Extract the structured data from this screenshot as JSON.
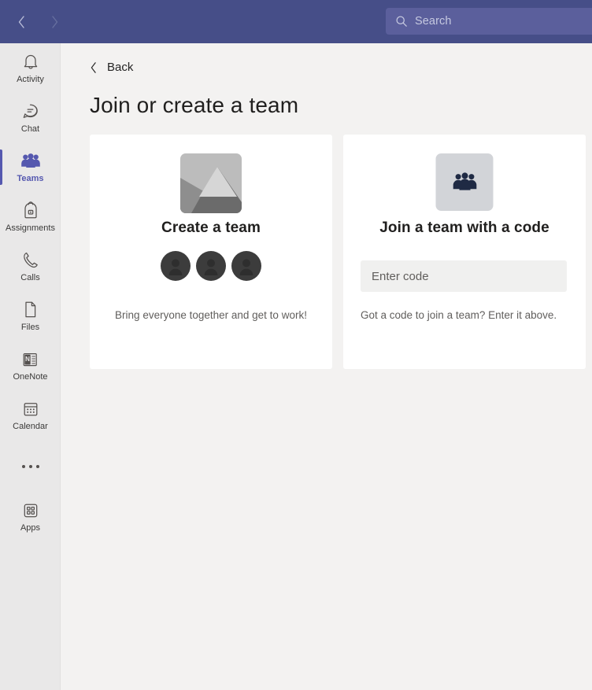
{
  "titlebar": {
    "back_arrow_icon": "chevron-left-icon",
    "forward_arrow_icon": "chevron-right-icon",
    "search": {
      "icon": "search-icon",
      "placeholder": "Search",
      "value": ""
    }
  },
  "sidebar": {
    "items": [
      {
        "id": "activity",
        "label": "Activity",
        "icon": "bell-icon",
        "active": false
      },
      {
        "id": "chat",
        "label": "Chat",
        "icon": "chat-icon",
        "active": false
      },
      {
        "id": "teams",
        "label": "Teams",
        "icon": "people-icon",
        "active": true
      },
      {
        "id": "assignments",
        "label": "Assignments",
        "icon": "backpack-icon",
        "active": false
      },
      {
        "id": "calls",
        "label": "Calls",
        "icon": "phone-icon",
        "active": false
      },
      {
        "id": "files",
        "label": "Files",
        "icon": "file-icon",
        "active": false
      },
      {
        "id": "onenote",
        "label": "OneNote",
        "icon": "onenote-icon",
        "active": false
      },
      {
        "id": "calendar",
        "label": "Calendar",
        "icon": "calendar-icon",
        "active": false
      }
    ],
    "more_icon": "ellipsis-icon",
    "apps": {
      "label": "Apps",
      "icon": "apps-grid-icon"
    }
  },
  "main": {
    "back_label": "Back",
    "back_icon": "chevron-left-icon",
    "page_title": "Join or create a team",
    "cards": [
      {
        "id": "create-team",
        "title": "Create a team",
        "subtitle": "Bring everyone together and get to work!",
        "tile_icon": "image-placeholder-icon",
        "avatar_count": 3,
        "avatar_icon": "person-silhouette-icon"
      },
      {
        "id": "join-team-with-code",
        "title": "Join a team with a code",
        "tile_icon": "people-group-icon",
        "input_placeholder": "Enter code",
        "input_value": "",
        "hint": "Got a code to join a team? Enter it above."
      }
    ]
  },
  "colors": {
    "titlebar_bg": "#464e88",
    "search_bg": "#5b5f9c",
    "rail_bg": "#e9e8e8",
    "page_bg": "#f3f2f1",
    "card_bg": "#ffffff",
    "accent": "#5558af",
    "input_bg": "#f0f0ef",
    "tile_box_bg": "#d2d4d8",
    "people_icon": "#1f2a44"
  }
}
